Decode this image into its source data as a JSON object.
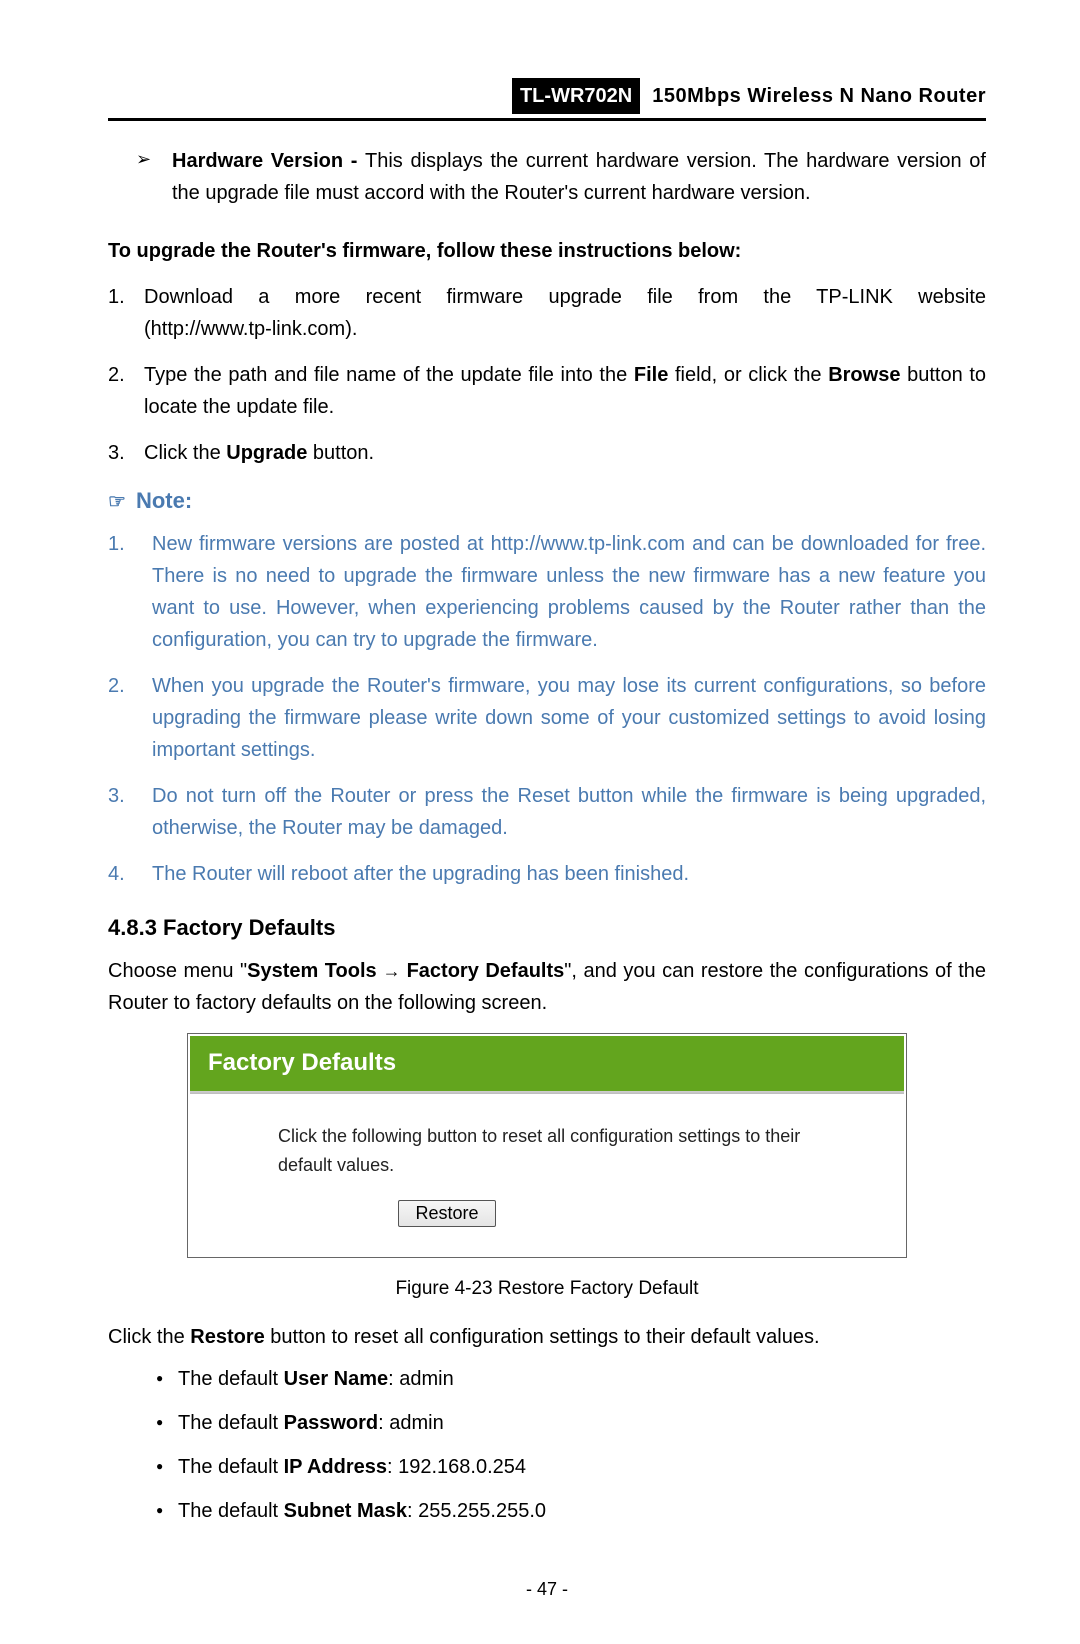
{
  "header": {
    "model": "TL-WR702N",
    "description": "150Mbps  Wireless  N  Nano  Router"
  },
  "arrow_item": {
    "label": "Hardware Version - ",
    "text": "This displays the current hardware version. The hardware version of the upgrade file must accord with the Router's current hardware version."
  },
  "instr_heading": "To upgrade the Router's firmware, follow these instructions below:",
  "steps": {
    "s1a": "Download a more recent firmware upgrade file from the TP-LINK website (",
    "s1b": "http://www.tp-link.com",
    "s1c": ").",
    "s2a": "Type the path and file name of the update file into the ",
    "s2b": "File",
    "s2c": " field, or click the ",
    "s2d": "Browse",
    "s2e": " button to locate the update file.",
    "s3a": "Click the ",
    "s3b": "Upgrade",
    "s3c": " button."
  },
  "note_label": "Note:",
  "note_items": {
    "n1a": "New firmware versions are posted at ",
    "n1b": "http://www.tp-link.com",
    "n1c": " and can be downloaded for free. There is no need to upgrade the firmware unless the new firmware has a new feature you want to use. However, when experiencing problems caused by the Router rather than the configuration, you can try to upgrade the firmware.",
    "n2": "When you upgrade the Router's firmware, you may lose its current configurations, so before upgrading the firmware please write down some of your customized settings to avoid losing important settings.",
    "n3": "Do not turn off the Router or press the Reset button while the firmware is being upgraded, otherwise, the Router may be damaged.",
    "n4": "The Router will reboot after the upgrading has been finished."
  },
  "section": {
    "num": "4.8.3",
    "title": "  Factory Defaults"
  },
  "section_intro": {
    "a": "Choose menu \"",
    "b": "System Tools",
    "arrow": " → ",
    "c": "Factory Defaults",
    "d": "\", and you can restore the configurations of the Router to factory defaults on the following screen."
  },
  "panel": {
    "title": "Factory Defaults",
    "msg": "Click the following button to reset all configuration settings to their default values.",
    "button": "Restore"
  },
  "figure_caption": "Figure 4-23 Restore Factory Default",
  "post_figure": {
    "a": "Click the ",
    "b": "Restore",
    "c": " button to reset all configuration settings to their default values."
  },
  "defaults": {
    "d1a": "The default ",
    "d1b": "User Name",
    "d1c": ": admin",
    "d2a": "The default ",
    "d2b": "Password",
    "d2c": ": admin",
    "d3a": "The default ",
    "d3b": "IP Address",
    "d3c": ": 192.168.0.254",
    "d4a": "The default ",
    "d4b": "Subnet Mask",
    "d4c": ": 255.255.255.0"
  },
  "page_number": "- 47 -"
}
